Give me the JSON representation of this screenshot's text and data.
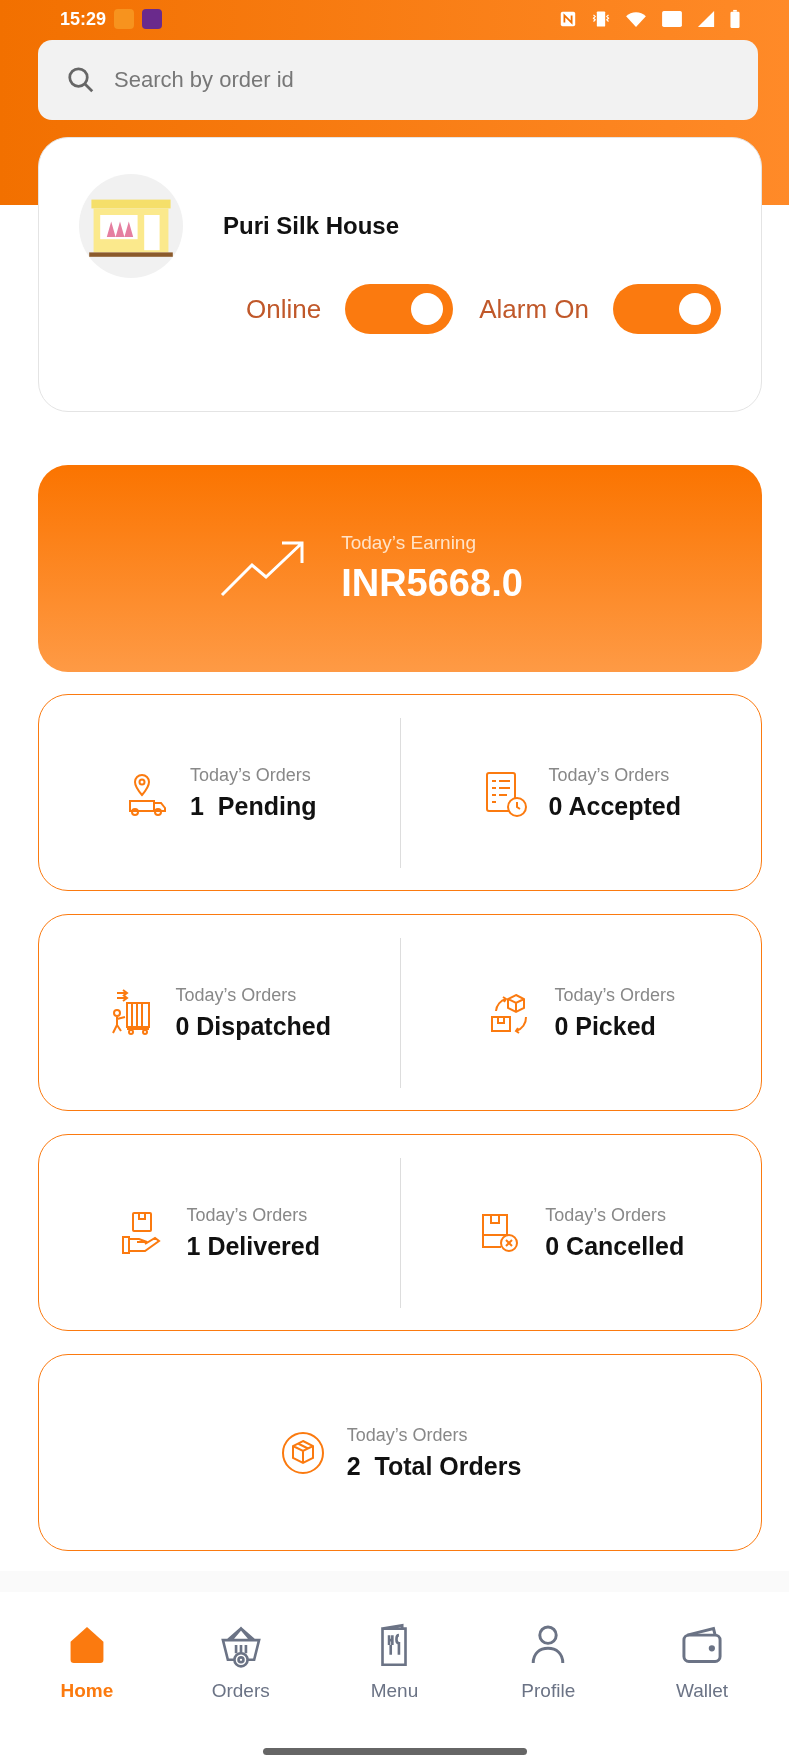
{
  "status_bar": {
    "time": "15:29"
  },
  "search": {
    "placeholder": "Search by order id"
  },
  "shop": {
    "name": "Puri Silk House",
    "toggles": [
      {
        "label": "Online",
        "on": true
      },
      {
        "label": "Alarm On",
        "on": true
      }
    ]
  },
  "earning": {
    "label": "Today’s Earning",
    "value": "INR5668.0"
  },
  "order_cards": [
    {
      "stats": [
        {
          "label": "Today’s Orders",
          "value": "1  Pending"
        },
        {
          "label": "Today’s Orders",
          "value": "0 Accepted"
        }
      ]
    },
    {
      "stats": [
        {
          "label": "Today’s Orders",
          "value": "0 Dispatched"
        },
        {
          "label": "Today’s Orders",
          "value": "0 Picked"
        }
      ]
    },
    {
      "stats": [
        {
          "label": "Today’s Orders",
          "value": "1 Delivered"
        },
        {
          "label": "Today’s Orders",
          "value": "0 Cancelled"
        }
      ]
    },
    {
      "stats": [
        {
          "label": "Today’s Orders",
          "value": "2  Total Orders"
        }
      ]
    }
  ],
  "bottom_nav": [
    {
      "label": "Home",
      "selected": true
    },
    {
      "label": "Orders",
      "selected": false
    },
    {
      "label": "Menu",
      "selected": false
    },
    {
      "label": "Profile",
      "selected": false
    },
    {
      "label": "Wallet",
      "selected": false
    }
  ]
}
